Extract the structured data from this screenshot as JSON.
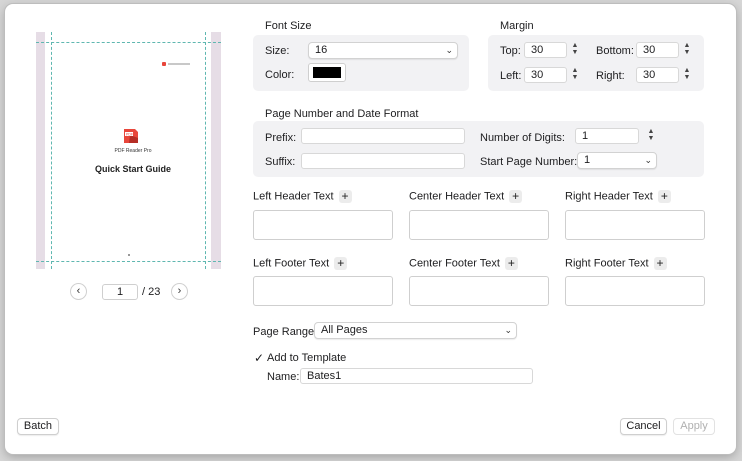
{
  "preview": {
    "logo_text": "PDF Reader Pro",
    "doc_title": "Quick Start Guide",
    "page_current": "1",
    "page_total": "/ 23"
  },
  "font_size": {
    "title": "Font Size",
    "size_label": "Size:",
    "size_value": "16",
    "color_label": "Color:",
    "color_value": "#000000"
  },
  "margin": {
    "title": "Margin",
    "top_label": "Top:",
    "top_value": "30",
    "bottom_label": "Bottom:",
    "bottom_value": "30",
    "left_label": "Left:",
    "left_value": "30",
    "right_label": "Right:",
    "right_value": "30"
  },
  "page_number_format": {
    "title": "Page Number and Date Format",
    "prefix_label": "Prefix:",
    "prefix_value": "",
    "suffix_label": "Suffix:",
    "suffix_value": "",
    "digits_label": "Number of Digits:",
    "digits_value": "1",
    "start_label": "Start Page Number:",
    "start_value": "1"
  },
  "headers": {
    "left": "Left Header Text",
    "center": "Center Header Text",
    "right": "Right Header Text"
  },
  "footers": {
    "left": "Left Footer Text",
    "center": "Center Footer Text",
    "right": "Right Footer Text"
  },
  "page_range": {
    "label": "Page Range:",
    "value": "All Pages"
  },
  "template": {
    "checkbox_label": "Add to Template",
    "checked": true,
    "name_label": "Name:",
    "name_value": "Bates1"
  },
  "buttons": {
    "batch": "Batch",
    "cancel": "Cancel",
    "apply": "Apply"
  },
  "colors": {
    "accent": "#e8463b",
    "preview_band": "#e6dde6",
    "guide_line": "#5fb7b0"
  }
}
